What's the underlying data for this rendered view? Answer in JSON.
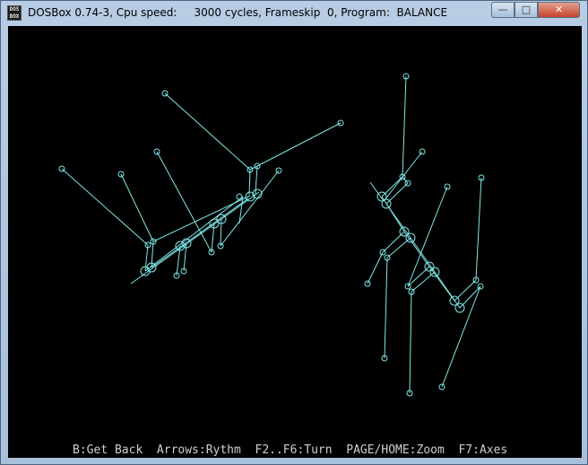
{
  "window": {
    "icon_text": "DOS BOX",
    "title": "DOSBox 0.74-3, Cpu speed:     3000 cycles, Frameskip  0, Program:  BALANCE",
    "minimize_glyph": "—",
    "maximize_glyph": "□",
    "close_glyph": "✕"
  },
  "screen": {
    "background": "#000000",
    "line_color": "#7fe8e8",
    "status_color": "#cfcfcf",
    "status_text": "B:Get Back  Arrows:Rythm  F2..F6:Turn  PAGE/HOME:Zoom  F7:Axes"
  }
}
